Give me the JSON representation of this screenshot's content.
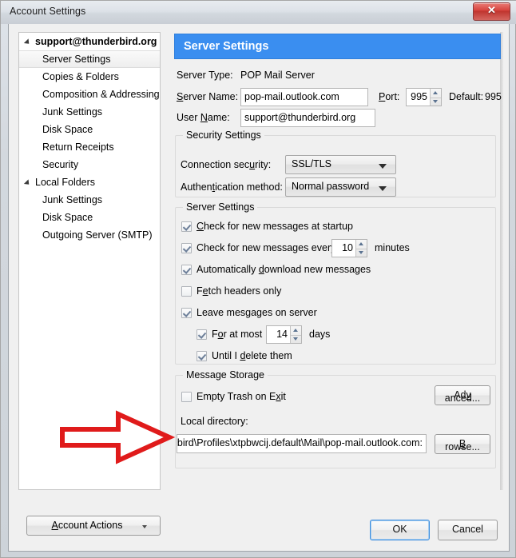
{
  "window": {
    "title": "Account Settings",
    "close_label": "✕"
  },
  "sidebar": {
    "items": [
      {
        "label": "support@thunderbird.org",
        "level": 0,
        "expandable": true,
        "bold": true,
        "selected": false
      },
      {
        "label": "Server Settings",
        "level": 1,
        "expandable": false,
        "bold": false,
        "selected": true
      },
      {
        "label": "Copies & Folders",
        "level": 1,
        "expandable": false,
        "bold": false,
        "selected": false
      },
      {
        "label": "Composition & Addressing",
        "level": 1,
        "expandable": false,
        "bold": false,
        "selected": false
      },
      {
        "label": "Junk Settings",
        "level": 1,
        "expandable": false,
        "bold": false,
        "selected": false
      },
      {
        "label": "Disk Space",
        "level": 1,
        "expandable": false,
        "bold": false,
        "selected": false
      },
      {
        "label": "Return Receipts",
        "level": 1,
        "expandable": false,
        "bold": false,
        "selected": false
      },
      {
        "label": "Security",
        "level": 1,
        "expandable": false,
        "bold": false,
        "selected": false
      },
      {
        "label": "Local Folders",
        "level": 0,
        "expandable": true,
        "bold": false,
        "selected": false
      },
      {
        "label": "Junk Settings",
        "level": 1,
        "expandable": false,
        "bold": false,
        "selected": false
      },
      {
        "label": "Disk Space",
        "level": 1,
        "expandable": false,
        "bold": false,
        "selected": false
      },
      {
        "label": "Outgoing Server (SMTP)",
        "level": 1,
        "expandable": false,
        "bold": false,
        "selected": false
      }
    ],
    "account_actions_label": "Account Actions",
    "account_actions_accesskey": "A"
  },
  "pane": {
    "banner_title": "Server Settings",
    "banner_color": "#3a8ef0",
    "server_type_label": "Server Type:",
    "server_type_value": "POP Mail Server",
    "server_name_label": "Server Name:",
    "server_name_value": "pop-mail.outlook.com",
    "port_label": "Port:",
    "port_value": "995",
    "default_label": "Default:",
    "default_value": "995",
    "user_name_label": "User Name:",
    "user_name_value": "support@thunderbird.org"
  },
  "security_settings": {
    "group_title": "Security Settings",
    "connection_security_label": "Connection security:",
    "connection_security_value": "SSL/TLS",
    "authentication_method_label": "Authentication method:",
    "authentication_method_value": "Normal password"
  },
  "server_settings": {
    "group_title": "Server Settings",
    "check_startup_label": "Check for new messages at startup",
    "check_startup_checked": true,
    "check_every_label": "Check for new messages every",
    "check_every_checked": true,
    "check_every_value": "10",
    "minutes_label": "minutes",
    "auto_download_label": "Automatically download new messages",
    "auto_download_checked": true,
    "fetch_headers_label": "Fetch headers only",
    "fetch_headers_checked": false,
    "leave_messages_label": "Leave messages on server",
    "leave_messages_checked": true,
    "for_at_most_label": "For at most",
    "for_at_most_checked": true,
    "for_at_most_value": "14",
    "days_label": "days",
    "until_delete_label": "Until I delete them",
    "until_delete_checked": true
  },
  "message_storage": {
    "group_title": "Message Storage",
    "empty_trash_label": "Empty Trash on Exit",
    "empty_trash_checked": false,
    "advanced_label": "Advanced...",
    "local_directory_label": "Local directory:",
    "local_directory_value": ":rbird\\Profiles\\xtpbwcij.default\\Mail\\pop-mail.outlook.com",
    "browse_label": "Browse..."
  },
  "footer": {
    "ok_label": "OK",
    "cancel_label": "Cancel"
  },
  "annotation": {
    "type": "red-arrow",
    "color": "#e01b1b",
    "points_to": "local-directory-input"
  }
}
